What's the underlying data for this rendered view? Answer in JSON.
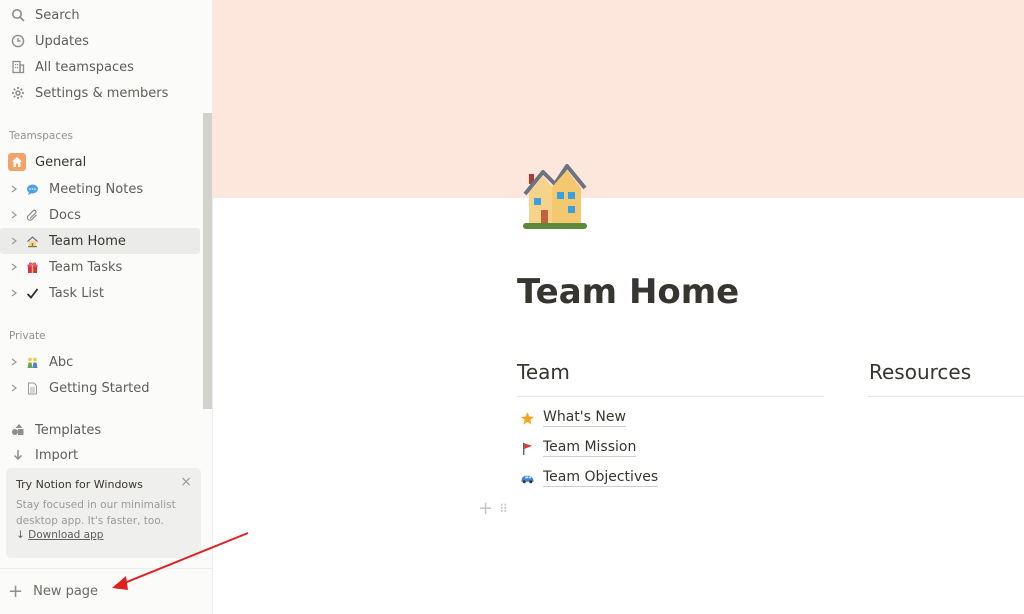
{
  "sidebar": {
    "top_items": [
      {
        "label": "Search",
        "icon": "search-icon"
      },
      {
        "label": "Updates",
        "icon": "clock-icon"
      },
      {
        "label": "All teamspaces",
        "icon": "building-icon"
      },
      {
        "label": "Settings & members",
        "icon": "gear-icon"
      }
    ],
    "teamspaces_label": "Teamspaces",
    "general_label": "General",
    "teamspace_items": [
      {
        "label": "Meeting Notes",
        "icon": "speech-bubble-icon"
      },
      {
        "label": "Docs",
        "icon": "paperclip-icon"
      },
      {
        "label": "Team Home",
        "icon": "house-icon",
        "active": true
      },
      {
        "label": "Team Tasks",
        "icon": "gift-icon"
      },
      {
        "label": "Task List",
        "icon": "checkmark-icon"
      }
    ],
    "private_label": "Private",
    "private_items": [
      {
        "label": "Abc",
        "icon": "people-icon"
      },
      {
        "label": "Getting Started",
        "icon": "page-icon"
      }
    ],
    "templates_label": "Templates",
    "import_label": "Import",
    "promo": {
      "title": "Try Notion for Windows",
      "text": "Stay focused in our minimalist desktop app. It's faster, too.",
      "link_arrow": "↓",
      "link": "Download app",
      "close": "×"
    },
    "new_page_label": "New page"
  },
  "main": {
    "cover_color": "#fde7dc",
    "page_icon": "house-with-garden-icon",
    "title": "Team Home",
    "columns": [
      {
        "heading": "Team",
        "links": [
          {
            "label": "What's New",
            "icon": "star-icon"
          },
          {
            "label": "Team Mission",
            "icon": "red-flag-icon"
          },
          {
            "label": "Team Objectives",
            "icon": "car-icon"
          }
        ]
      },
      {
        "heading": "Resources",
        "links": []
      }
    ]
  },
  "annotation": {
    "color": "#e02020"
  }
}
